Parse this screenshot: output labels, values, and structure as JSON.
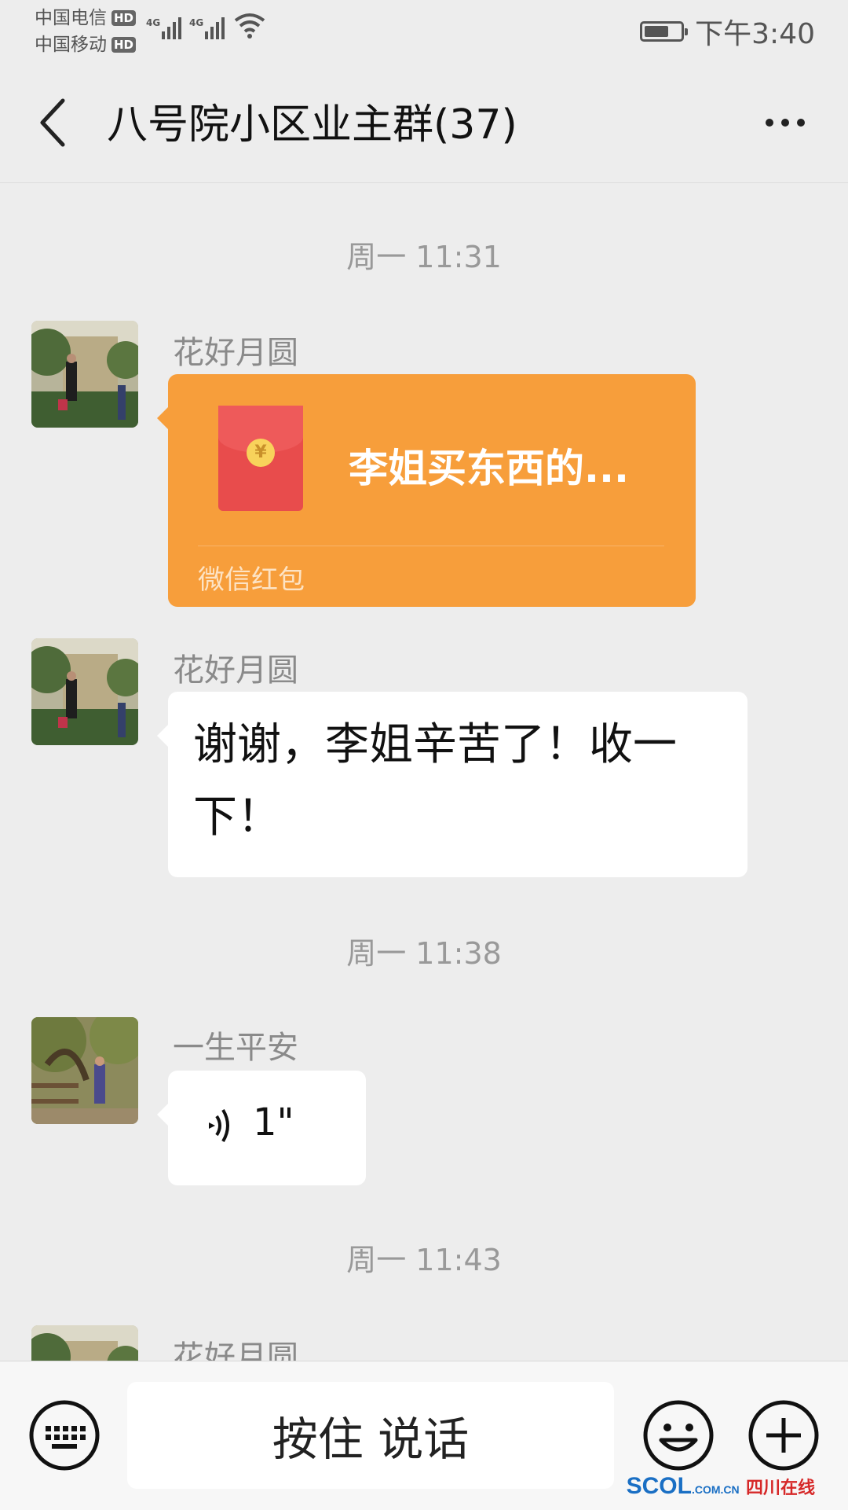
{
  "status_bar": {
    "carrier1": "中国电信",
    "carrier2": "中国移动",
    "hd_badge": "HD",
    "network_label": "4G",
    "clock": "下午3:40"
  },
  "header": {
    "title": "八号院小区业主群(37)"
  },
  "messages": [
    {
      "type": "timestamp",
      "text": "周一 11:31"
    },
    {
      "type": "red_packet",
      "sender": "花好月圆",
      "title": "李姐买东西的...",
      "label": "微信红包"
    },
    {
      "type": "text",
      "sender": "花好月圆",
      "text": "谢谢，李姐辛苦了！收一下！"
    },
    {
      "type": "timestamp",
      "text": "周一 11:38"
    },
    {
      "type": "voice",
      "sender": "一生平安",
      "duration": "1\""
    },
    {
      "type": "timestamp",
      "text": "周一 11:43"
    },
    {
      "type": "text",
      "sender": "花好月圆"
    }
  ],
  "input_bar": {
    "hold_to_talk_label": "按住 说话"
  },
  "watermark": {
    "brand": "SCOL",
    "domain": ".COM.CN",
    "name": "四川在线"
  },
  "colors": {
    "background": "#ededed",
    "red_packet": "#f79e3b",
    "bubble": "#ffffff"
  }
}
